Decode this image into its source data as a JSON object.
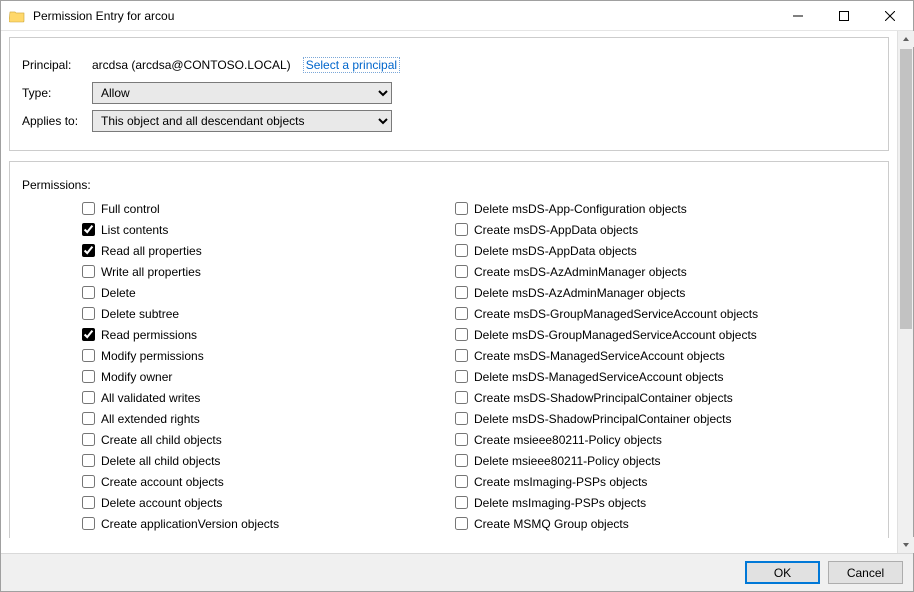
{
  "window": {
    "title": "Permission Entry for arcou"
  },
  "header": {
    "principal_label": "Principal:",
    "principal_value": "arcdsa (arcdsa@CONTOSO.LOCAL)",
    "select_principal_link": "Select a principal",
    "type_label": "Type:",
    "type_value": "Allow",
    "applies_label": "Applies to:",
    "applies_value": "This object and all descendant objects"
  },
  "permissions_label": "Permissions:",
  "permissions_col1": [
    {
      "label": "Full control",
      "checked": false
    },
    {
      "label": "List contents",
      "checked": true
    },
    {
      "label": "Read all properties",
      "checked": true
    },
    {
      "label": "Write all properties",
      "checked": false
    },
    {
      "label": "Delete",
      "checked": false
    },
    {
      "label": "Delete subtree",
      "checked": false
    },
    {
      "label": "Read permissions",
      "checked": true
    },
    {
      "label": "Modify permissions",
      "checked": false
    },
    {
      "label": "Modify owner",
      "checked": false
    },
    {
      "label": "All validated writes",
      "checked": false
    },
    {
      "label": "All extended rights",
      "checked": false
    },
    {
      "label": "Create all child objects",
      "checked": false
    },
    {
      "label": "Delete all child objects",
      "checked": false
    },
    {
      "label": "Create account objects",
      "checked": false
    },
    {
      "label": "Delete account objects",
      "checked": false
    },
    {
      "label": "Create applicationVersion objects",
      "checked": false
    }
  ],
  "permissions_col2": [
    {
      "label": "Delete msDS-App-Configuration objects",
      "checked": false
    },
    {
      "label": "Create msDS-AppData objects",
      "checked": false
    },
    {
      "label": "Delete msDS-AppData objects",
      "checked": false
    },
    {
      "label": "Create msDS-AzAdminManager objects",
      "checked": false
    },
    {
      "label": "Delete msDS-AzAdminManager objects",
      "checked": false
    },
    {
      "label": "Create msDS-GroupManagedServiceAccount objects",
      "checked": false
    },
    {
      "label": "Delete msDS-GroupManagedServiceAccount objects",
      "checked": false
    },
    {
      "label": "Create msDS-ManagedServiceAccount objects",
      "checked": false
    },
    {
      "label": "Delete msDS-ManagedServiceAccount objects",
      "checked": false
    },
    {
      "label": "Create msDS-ShadowPrincipalContainer objects",
      "checked": false
    },
    {
      "label": "Delete msDS-ShadowPrincipalContainer objects",
      "checked": false
    },
    {
      "label": "Create msieee80211-Policy objects",
      "checked": false
    },
    {
      "label": "Delete msieee80211-Policy objects",
      "checked": false
    },
    {
      "label": "Create msImaging-PSPs objects",
      "checked": false
    },
    {
      "label": "Delete msImaging-PSPs objects",
      "checked": false
    },
    {
      "label": "Create MSMQ Group objects",
      "checked": false
    }
  ],
  "buttons": {
    "ok": "OK",
    "cancel": "Cancel"
  }
}
